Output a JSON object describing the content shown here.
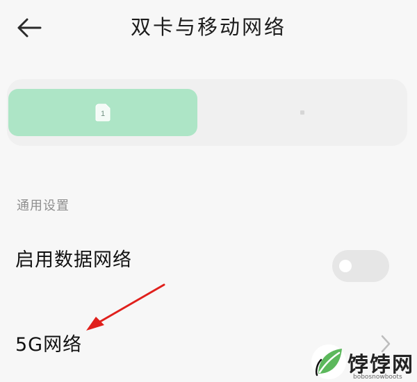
{
  "header": {
    "title": "双卡与移动网络",
    "back_icon": "arrow-left-icon"
  },
  "sim_tabs": {
    "tab1_label": "1",
    "tab1_color": "#ade5c6",
    "tab1_selected": true,
    "tab2_selected": false
  },
  "sections": {
    "general_title": "通用设置"
  },
  "rows": {
    "mobile_data_label": "启用数据网络",
    "mobile_data_enabled": false,
    "five_g_label": "5G网络",
    "five_g_icon": "chevron-right-icon"
  },
  "annotation": {
    "arrow_color": "#e0201c"
  },
  "watermark": {
    "text": "饽饽网",
    "sub": "bobosnowboots"
  }
}
